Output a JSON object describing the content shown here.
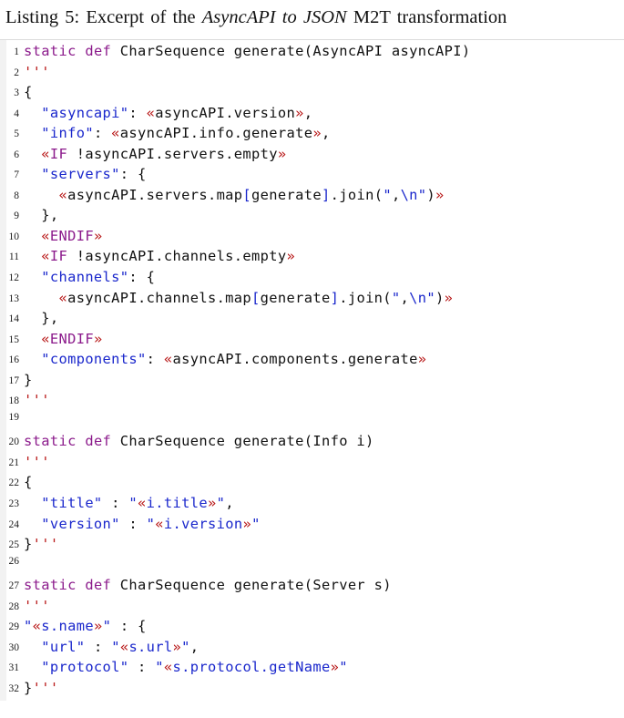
{
  "caption": {
    "prefix": "Listing 5: Excerpt of the ",
    "italic": "AsyncAPI to JSON",
    "suffix": " M2T transformation"
  },
  "colors": {
    "keyword_purple": "#8b1a8b",
    "string_blue": "#1a27cc",
    "template_red": "#b81818",
    "plain_text": "#111111",
    "gutter_band": "#f2f2f2",
    "rule": "#dcdcdc",
    "page_background": "#ffffff"
  },
  "listing": {
    "language": "Xtend",
    "line_count": 32,
    "lines": [
      {
        "n": "1",
        "tokens": [
          {
            "t": "static",
            "c": "kw"
          },
          {
            "t": " ",
            "c": "pln"
          },
          {
            "t": "def",
            "c": "kw"
          },
          {
            "t": " CharSequence generate(AsyncAPI asyncAPI)",
            "c": "pln"
          }
        ]
      },
      {
        "n": "2",
        "tokens": [
          {
            "t": "'''",
            "c": "tpl"
          }
        ]
      },
      {
        "n": "3",
        "tokens": [
          {
            "t": "{",
            "c": "pln"
          }
        ]
      },
      {
        "n": "4",
        "tokens": [
          {
            "t": "  ",
            "c": "pln"
          },
          {
            "t": "\"asyncapi\"",
            "c": "str"
          },
          {
            "t": ": ",
            "c": "pln"
          },
          {
            "t": "«",
            "c": "tpl"
          },
          {
            "t": "asyncAPI.version",
            "c": "pln"
          },
          {
            "t": "»",
            "c": "tpl"
          },
          {
            "t": ",",
            "c": "pln"
          }
        ]
      },
      {
        "n": "5",
        "tokens": [
          {
            "t": "  ",
            "c": "pln"
          },
          {
            "t": "\"info\"",
            "c": "str"
          },
          {
            "t": ": ",
            "c": "pln"
          },
          {
            "t": "«",
            "c": "tpl"
          },
          {
            "t": "asyncAPI.info.generate",
            "c": "pln"
          },
          {
            "t": "»",
            "c": "tpl"
          },
          {
            "t": ",",
            "c": "pln"
          }
        ]
      },
      {
        "n": "6",
        "tokens": [
          {
            "t": "  ",
            "c": "pln"
          },
          {
            "t": "«",
            "c": "tpl"
          },
          {
            "t": "IF",
            "c": "kw"
          },
          {
            "t": " !asyncAPI.servers.empty",
            "c": "pln"
          },
          {
            "t": "»",
            "c": "tpl"
          }
        ]
      },
      {
        "n": "7",
        "tokens": [
          {
            "t": "  ",
            "c": "pln"
          },
          {
            "t": "\"servers\"",
            "c": "str"
          },
          {
            "t": ": {",
            "c": "pln"
          }
        ]
      },
      {
        "n": "8",
        "tokens": [
          {
            "t": "    ",
            "c": "pln"
          },
          {
            "t": "«",
            "c": "tpl"
          },
          {
            "t": "asyncAPI.servers.map",
            "c": "pln"
          },
          {
            "t": "[",
            "c": "str"
          },
          {
            "t": "generate",
            "c": "pln"
          },
          {
            "t": "]",
            "c": "str"
          },
          {
            "t": ".join(",
            "c": "pln"
          },
          {
            "t": "\"",
            "c": "str"
          },
          {
            "t": ",",
            "c": "pln"
          },
          {
            "t": "\\n",
            "c": "str"
          },
          {
            "t": "\"",
            "c": "str"
          },
          {
            "t": ")",
            "c": "pln"
          },
          {
            "t": "»",
            "c": "tpl"
          }
        ]
      },
      {
        "n": "9",
        "tokens": [
          {
            "t": "  },",
            "c": "pln"
          }
        ]
      },
      {
        "n": "10",
        "tokens": [
          {
            "t": "  ",
            "c": "pln"
          },
          {
            "t": "«",
            "c": "tpl"
          },
          {
            "t": "ENDIF",
            "c": "kw"
          },
          {
            "t": "»",
            "c": "tpl"
          }
        ]
      },
      {
        "n": "11",
        "tokens": [
          {
            "t": "  ",
            "c": "pln"
          },
          {
            "t": "«",
            "c": "tpl"
          },
          {
            "t": "IF",
            "c": "kw"
          },
          {
            "t": " !asyncAPI.channels.empty",
            "c": "pln"
          },
          {
            "t": "»",
            "c": "tpl"
          }
        ]
      },
      {
        "n": "12",
        "tokens": [
          {
            "t": "  ",
            "c": "pln"
          },
          {
            "t": "\"channels\"",
            "c": "str"
          },
          {
            "t": ": {",
            "c": "pln"
          }
        ]
      },
      {
        "n": "13",
        "tokens": [
          {
            "t": "    ",
            "c": "pln"
          },
          {
            "t": "«",
            "c": "tpl"
          },
          {
            "t": "asyncAPI.channels.map",
            "c": "pln"
          },
          {
            "t": "[",
            "c": "str"
          },
          {
            "t": "generate",
            "c": "pln"
          },
          {
            "t": "]",
            "c": "str"
          },
          {
            "t": ".join(",
            "c": "pln"
          },
          {
            "t": "\"",
            "c": "str"
          },
          {
            "t": ",",
            "c": "pln"
          },
          {
            "t": "\\n",
            "c": "str"
          },
          {
            "t": "\"",
            "c": "str"
          },
          {
            "t": ")",
            "c": "pln"
          },
          {
            "t": "»",
            "c": "tpl"
          }
        ]
      },
      {
        "n": "14",
        "tokens": [
          {
            "t": "  },",
            "c": "pln"
          }
        ]
      },
      {
        "n": "15",
        "tokens": [
          {
            "t": "  ",
            "c": "pln"
          },
          {
            "t": "«",
            "c": "tpl"
          },
          {
            "t": "ENDIF",
            "c": "kw"
          },
          {
            "t": "»",
            "c": "tpl"
          }
        ]
      },
      {
        "n": "16",
        "tokens": [
          {
            "t": "  ",
            "c": "pln"
          },
          {
            "t": "\"components\"",
            "c": "str"
          },
          {
            "t": ": ",
            "c": "pln"
          },
          {
            "t": "«",
            "c": "tpl"
          },
          {
            "t": "asyncAPI.components.generate",
            "c": "pln"
          },
          {
            "t": "»",
            "c": "tpl"
          }
        ]
      },
      {
        "n": "17",
        "tokens": [
          {
            "t": "}",
            "c": "pln"
          }
        ]
      },
      {
        "n": "18",
        "tokens": [
          {
            "t": "'''",
            "c": "tpl"
          }
        ]
      },
      {
        "n": "19",
        "tokens": [
          {
            "t": "",
            "c": "pln"
          }
        ]
      },
      {
        "n": "20",
        "tokens": [
          {
            "t": "static",
            "c": "kw"
          },
          {
            "t": " ",
            "c": "pln"
          },
          {
            "t": "def",
            "c": "kw"
          },
          {
            "t": " CharSequence generate(Info i)",
            "c": "pln"
          }
        ]
      },
      {
        "n": "21",
        "tokens": [
          {
            "t": "'''",
            "c": "tpl"
          }
        ]
      },
      {
        "n": "22",
        "tokens": [
          {
            "t": "{",
            "c": "pln"
          }
        ]
      },
      {
        "n": "23",
        "tokens": [
          {
            "t": "  ",
            "c": "pln"
          },
          {
            "t": "\"title\"",
            "c": "str"
          },
          {
            "t": " : ",
            "c": "pln"
          },
          {
            "t": "\"",
            "c": "str"
          },
          {
            "t": "«",
            "c": "tpl"
          },
          {
            "t": "i.title",
            "c": "str"
          },
          {
            "t": "»",
            "c": "tpl"
          },
          {
            "t": "\"",
            "c": "str"
          },
          {
            "t": ",",
            "c": "pln"
          }
        ]
      },
      {
        "n": "24",
        "tokens": [
          {
            "t": "  ",
            "c": "pln"
          },
          {
            "t": "\"version\"",
            "c": "str"
          },
          {
            "t": " : ",
            "c": "pln"
          },
          {
            "t": "\"",
            "c": "str"
          },
          {
            "t": "«",
            "c": "tpl"
          },
          {
            "t": "i.version",
            "c": "str"
          },
          {
            "t": "»",
            "c": "tpl"
          },
          {
            "t": "\"",
            "c": "str"
          }
        ]
      },
      {
        "n": "25",
        "tokens": [
          {
            "t": "}",
            "c": "pln"
          },
          {
            "t": "'''",
            "c": "tpl"
          }
        ]
      },
      {
        "n": "26",
        "tokens": [
          {
            "t": "",
            "c": "pln"
          }
        ]
      },
      {
        "n": "27",
        "tokens": [
          {
            "t": "static",
            "c": "kw"
          },
          {
            "t": " ",
            "c": "pln"
          },
          {
            "t": "def",
            "c": "kw"
          },
          {
            "t": " CharSequence generate(Server s)",
            "c": "pln"
          }
        ]
      },
      {
        "n": "28",
        "tokens": [
          {
            "t": "'''",
            "c": "tpl"
          }
        ]
      },
      {
        "n": "29",
        "tokens": [
          {
            "t": "\"",
            "c": "str"
          },
          {
            "t": "«",
            "c": "tpl"
          },
          {
            "t": "s.name",
            "c": "str"
          },
          {
            "t": "»",
            "c": "tpl"
          },
          {
            "t": "\"",
            "c": "str"
          },
          {
            "t": " : {",
            "c": "pln"
          }
        ]
      },
      {
        "n": "30",
        "tokens": [
          {
            "t": "  ",
            "c": "pln"
          },
          {
            "t": "\"url\"",
            "c": "str"
          },
          {
            "t": " : ",
            "c": "pln"
          },
          {
            "t": "\"",
            "c": "str"
          },
          {
            "t": "«",
            "c": "tpl"
          },
          {
            "t": "s.url",
            "c": "str"
          },
          {
            "t": "»",
            "c": "tpl"
          },
          {
            "t": "\"",
            "c": "str"
          },
          {
            "t": ",",
            "c": "pln"
          }
        ]
      },
      {
        "n": "31",
        "tokens": [
          {
            "t": "  ",
            "c": "pln"
          },
          {
            "t": "\"protocol\"",
            "c": "str"
          },
          {
            "t": " : ",
            "c": "pln"
          },
          {
            "t": "\"",
            "c": "str"
          },
          {
            "t": "«",
            "c": "tpl"
          },
          {
            "t": "s.protocol.getName",
            "c": "str"
          },
          {
            "t": "»",
            "c": "tpl"
          },
          {
            "t": "\"",
            "c": "str"
          }
        ]
      },
      {
        "n": "32",
        "tokens": [
          {
            "t": "}",
            "c": "pln"
          },
          {
            "t": "'''",
            "c": "tpl"
          }
        ]
      }
    ]
  }
}
